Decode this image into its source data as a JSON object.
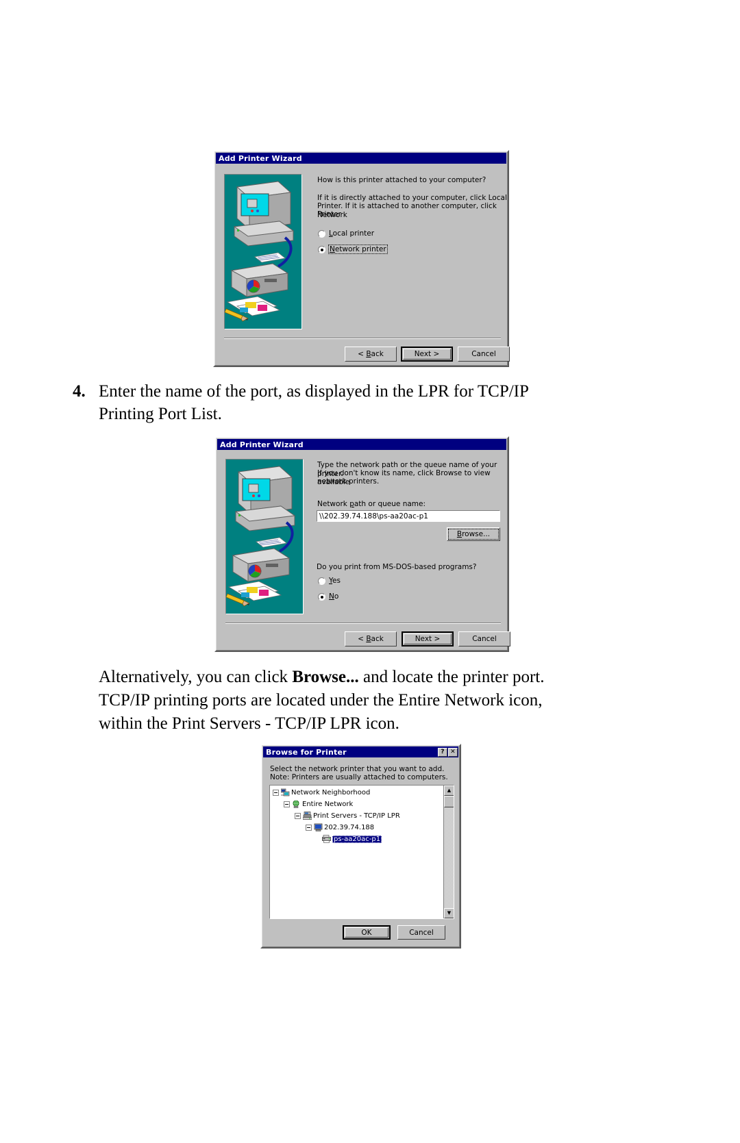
{
  "document": {
    "step": {
      "number": "4.",
      "line1": "Enter the name of the port, as displayed in the LPR for TCP/IP",
      "line2": "Printing Port List."
    },
    "paragraph": {
      "line1_a": "Alternatively, you can click ",
      "line1_b": "Browse...",
      "line1_c": " and locate the printer port.",
      "line2": "TCP/IP printing ports are located under the Entire Network icon,",
      "line3": "within the Print Servers - TCP/IP LPR icon."
    }
  },
  "dialog1": {
    "title": "Add Printer Wizard",
    "heading": "How is this printer attached to your computer?",
    "body_line1": "If it is directly attached to your computer, click Local",
    "body_line2": "Printer. If it is attached to another computer, click Network",
    "body_line3": "Printer",
    "radios": [
      {
        "label_pre": "",
        "label_accel": "L",
        "label_post": "ocal printer",
        "selected": false,
        "focused": false
      },
      {
        "label_pre": "",
        "label_accel": "N",
        "label_post": "etwork printer",
        "selected": true,
        "focused": true
      }
    ],
    "buttons": [
      {
        "label_pre": "< ",
        "label_accel": "B",
        "label_post": "ack",
        "default": false
      },
      {
        "label_pre": "",
        "label_accel": "",
        "label_post": "Next >",
        "default": true
      },
      {
        "label_pre": "",
        "label_accel": "",
        "label_post": "Cancel",
        "default": false
      }
    ]
  },
  "dialog2": {
    "title": "Add Printer Wizard",
    "body_line1": "Type the network path or the queue name of your printer.",
    "body_line2": "If you don't know its name, click Browse to view available",
    "body_line3": "network printers.",
    "field_label_pre": "Network ",
    "field_label_accel": "p",
    "field_label_post": "ath or queue name:",
    "field_value": "\\\\202.39.74.188\\ps-aa20ac-p1",
    "browse_button": {
      "label_pre": "B",
      "label_accel": "r",
      "label_post": "owse..."
    },
    "question": "Do you print from MS-DOS-based programs?",
    "radios": [
      {
        "label_pre": "",
        "label_accel": "Y",
        "label_post": "es",
        "selected": false
      },
      {
        "label_pre": "",
        "label_accel": "N",
        "label_post": "o",
        "selected": true
      }
    ],
    "buttons": [
      {
        "label_pre": "< ",
        "label_accel": "B",
        "label_post": "ack",
        "default": false
      },
      {
        "label_pre": "",
        "label_accel": "",
        "label_post": "Next >",
        "default": true
      },
      {
        "label_pre": "",
        "label_accel": "",
        "label_post": "Cancel",
        "default": false
      }
    ]
  },
  "dialog3": {
    "title": "Browse for Printer",
    "titlebar_buttons": [
      "?",
      "✕"
    ],
    "instruction_line1": "Select the network printer that you want to add.",
    "instruction_line2": "Note: Printers are usually attached to computers.",
    "tree": [
      {
        "label": "Network Neighborhood",
        "depth": 0,
        "icon": "network-neighborhood-icon",
        "expanded": true,
        "selected": false
      },
      {
        "label": "Entire Network",
        "depth": 1,
        "icon": "globe-icon",
        "expanded": true,
        "selected": false
      },
      {
        "label": "Print Servers - TCP/IP LPR",
        "depth": 2,
        "icon": "server-group-icon",
        "expanded": true,
        "selected": false
      },
      {
        "label": "202.39.74.188",
        "depth": 3,
        "icon": "computer-icon",
        "expanded": true,
        "selected": false
      },
      {
        "label": "ps-aa20ac-p1",
        "depth": 4,
        "icon": "printer-icon",
        "expanded": false,
        "selected": true
      }
    ],
    "buttons": [
      {
        "label": "OK",
        "default": true
      },
      {
        "label": "Cancel",
        "default": false
      }
    ]
  },
  "colors": {
    "titlebar": "#000080",
    "dialog_face": "#c0c0c0",
    "illustration_bg": "#008080",
    "selection": "#000080"
  }
}
